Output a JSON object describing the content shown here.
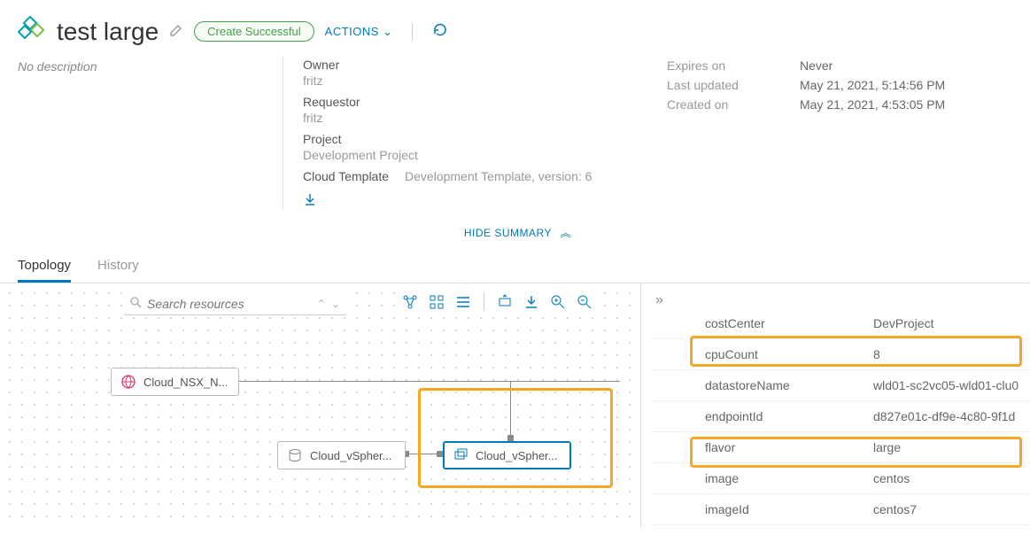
{
  "header": {
    "title": "test large",
    "status": "Create Successful",
    "actions_label": "ACTIONS"
  },
  "summary": {
    "description": "No description",
    "owner_label": "Owner",
    "owner_value": "fritz",
    "requestor_label": "Requestor",
    "requestor_value": "fritz",
    "project_label": "Project",
    "project_value": "Development Project",
    "template_label": "Cloud Template",
    "template_value": "Development Template, version: 6",
    "expires_label": "Expires on",
    "expires_value": "Never",
    "updated_label": "Last updated",
    "updated_value": "May 21, 2021, 5:14:56 PM",
    "created_label": "Created on",
    "created_value": "May 21, 2021, 4:53:05 PM",
    "hide_summary": "HIDE SUMMARY"
  },
  "tabs": {
    "topology": "Topology",
    "history": "History"
  },
  "search": {
    "placeholder": "Search resources"
  },
  "nodes": {
    "net": "Cloud_NSX_N...",
    "disk": "Cloud_vSpher...",
    "vm": "Cloud_vSpher..."
  },
  "properties": [
    {
      "key": "costCenter",
      "value": "DevProject"
    },
    {
      "key": "cpuCount",
      "value": "8"
    },
    {
      "key": "datastoreName",
      "value": "wld01-sc2vc05-wld01-clu0"
    },
    {
      "key": "endpointId",
      "value": "d827e01c-df9e-4c80-9f1d"
    },
    {
      "key": "flavor",
      "value": "large"
    },
    {
      "key": "image",
      "value": "centos"
    },
    {
      "key": "imageId",
      "value": "centos7"
    }
  ]
}
